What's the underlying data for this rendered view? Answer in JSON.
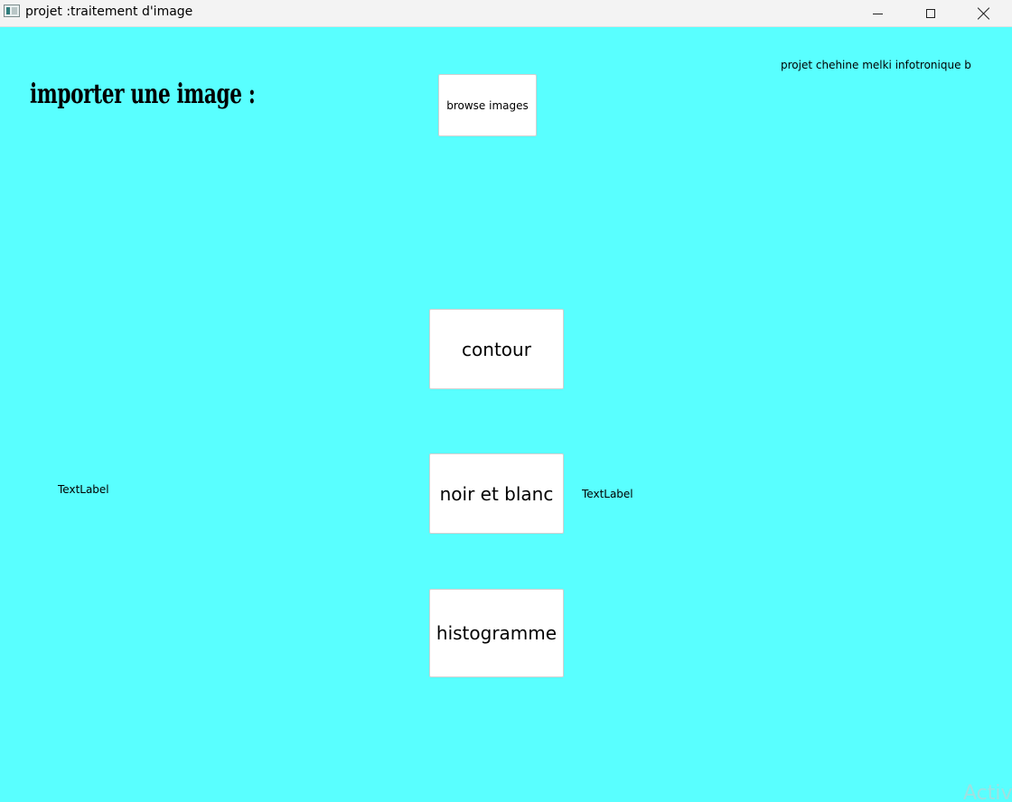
{
  "window": {
    "title": "projet :traitement d'image"
  },
  "header": {
    "import_label": "importer une image :",
    "credit": "projet chehine melki infotronique b"
  },
  "buttons": {
    "browse": "browse images",
    "contour": "contour",
    "noir_et_blanc": "noir et blanc",
    "histogramme": "histogramme"
  },
  "labels": {
    "left": "TextLabel",
    "right": "TextLabel"
  },
  "watermark": "Activ",
  "colors": {
    "background": "#59ffff",
    "button": "#ffffff"
  }
}
